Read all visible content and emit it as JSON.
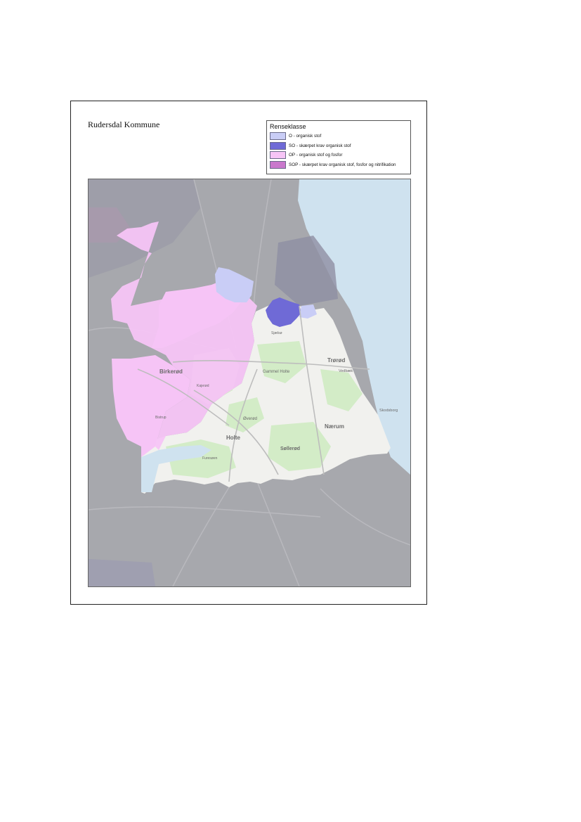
{
  "title": "Rudersdal Kommune",
  "legend": {
    "title": "Renseklasse",
    "items": [
      {
        "label": "O - organisk stof",
        "color": "#c9cdf6"
      },
      {
        "label": "SO - skærpet krav organisk stof",
        "color": "#6f6ad6"
      },
      {
        "label": "OP - organisk stof og fosfor",
        "color": "#f6c4f6"
      },
      {
        "label": "SOP - skærpet krav organisk stof, fosfor og nitrifikation",
        "color": "#c978cc"
      }
    ]
  },
  "places": {
    "birkerod": "Birkerød",
    "holte": "Holte",
    "trorod": "Trørød",
    "naerum": "Nærum",
    "sollerod": "Søllerød",
    "gammel_holte": "Gammel Holte",
    "vedbaek": "Vedbæk",
    "skodsborg": "Skodsborg",
    "overod": "Øverød",
    "kajerod": "Kajerød",
    "sjaelso": "Sjælsø",
    "bistrup": "Bistrup",
    "furesoen": "Furesøen"
  },
  "colors": {
    "sea": "#cfe2ef",
    "outside": "#a7a8ad",
    "land": "#f1f1ee",
    "green": "#d3ecc7",
    "o": "#c9cdf6",
    "so": "#6f6ad6",
    "op": "#f6c4f6"
  }
}
